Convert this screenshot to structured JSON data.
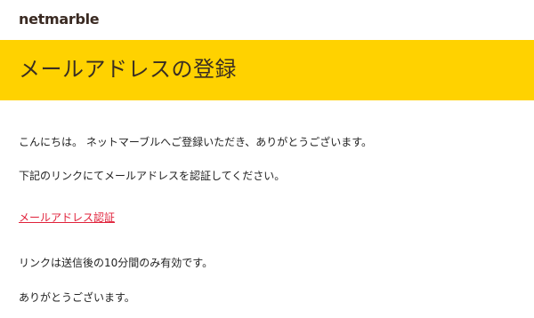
{
  "header": {
    "logo_text": "netmarble"
  },
  "banner": {
    "title": "メールアドレスの登録"
  },
  "content": {
    "greeting": "こんにちは。 ネットマーブルへご登録いただき、ありがとうございます。",
    "instruction": "下記のリンクにてメールアドレスを認証してください。",
    "verify_link": "メールアドレス認証",
    "expiry_note": "リンクは送信後の10分間のみ有効です。",
    "thanks": "ありがとうございます。"
  },
  "colors": {
    "banner_background": "#FFD200",
    "link": "#e0213a",
    "logo": "#3a2a22"
  }
}
